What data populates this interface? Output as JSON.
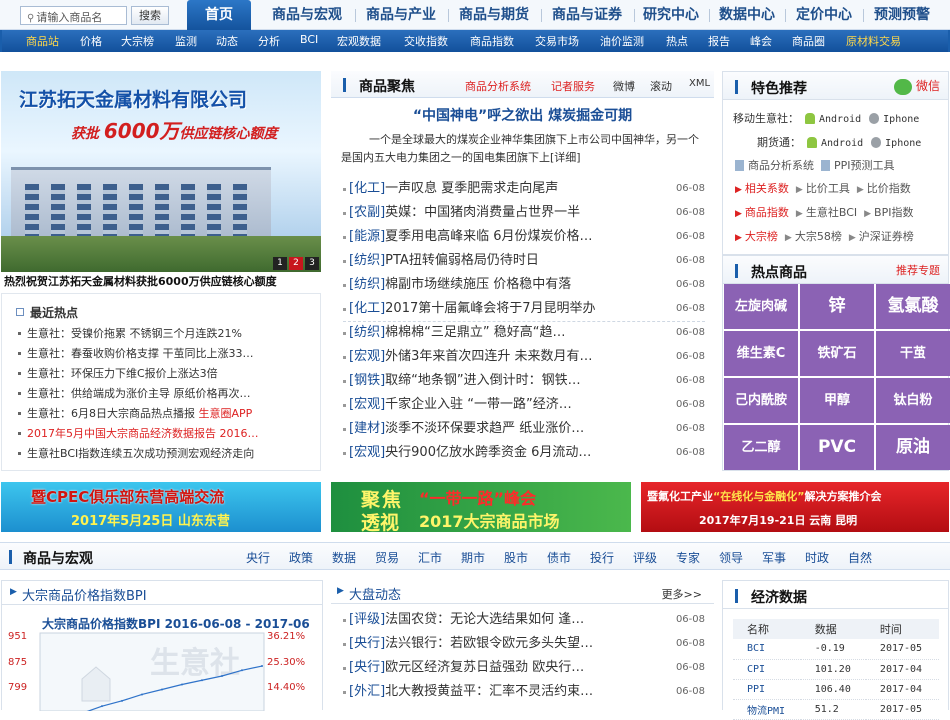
{
  "search": {
    "placeholder": "请输入商品名",
    "button": "搜索"
  },
  "main_nav": [
    "首页",
    "商品与宏观",
    "商品与产业",
    "商品与期货",
    "商品与证券",
    "研究中心",
    "数据中心",
    "定价中心",
    "预测预警"
  ],
  "sub_nav": [
    "商品站",
    "价格",
    "大宗榜",
    "监测",
    "动态",
    "分析",
    "BCI",
    "宏观数据",
    "交收指数",
    "商品指数",
    "交易市场",
    "油价监测",
    "热点",
    "报告",
    "峰会",
    "商品圈",
    "原材料交易"
  ],
  "hero": {
    "company": "江苏拓天金属材料有限公司",
    "line_pre": "获批",
    "line_amount": "6000万",
    "line_post": "供应链核心额度",
    "pages": [
      "1",
      "2",
      "3"
    ],
    "caption": "热烈祝贺江苏拓天金属材料获批6000万供应链核心额度"
  },
  "recent_hot": {
    "title": "最近热点",
    "items": [
      "生意社：受镍价拖累 不锈钢三个月连跌21%",
      "生意社：春蚕收购价格支撑 干茧同比上涨33…",
      "生意社：环保压力下维C报价上涨达3倍",
      "生意社：供给端成为涨价主导 原纸价格再次…",
      "生意社：6月8日大宗商品热点播报",
      "2017年5月中国大宗商品经济数据报告 2016…",
      "生意社BCI指数连续五次成功预测宏观经济走向"
    ],
    "app_link": "生意圈APP"
  },
  "focus": {
    "title": "商品聚焦",
    "links": [
      "商品分析系统",
      "记者服务",
      "微博",
      "滚动",
      "XML"
    ],
    "headline": "“中国神电”呼之欲出 煤炭掘金可期",
    "summary": "一个是全球最大的煤炭企业神华集团旗下上市公司中国神华，另一个是国内五大电力集团之一的国电集团旗下上[详细]",
    "news": [
      {
        "tag": "[化工]",
        "title": "一声叹息 夏季肥需求走向尾声",
        "date": "06-08"
      },
      {
        "tag": "[农副]",
        "title": "英媒：中国猪肉消费量占世界一半",
        "date": "06-08"
      },
      {
        "tag": "[能源]",
        "title": "夏季用电高峰来临 6月份煤炭价格…",
        "date": "06-08"
      },
      {
        "tag": "[纺织]",
        "title": "PTA扭转偏弱格局仍待时日",
        "date": "06-08"
      },
      {
        "tag": "[纺织]",
        "title": "棉副市场继续施压 价格稳中有落",
        "date": "06-08"
      },
      {
        "tag": "[化工]",
        "title": "2017第十届氟峰会将于7月昆明举办",
        "date": "06-08"
      },
      {
        "tag": "[纺织]",
        "title": "棉棉棉“三足鼎立” 稳好高“趋…",
        "date": "06-08"
      },
      {
        "tag": "[宏观]",
        "title": "外储3年来首次四连升 未来数月有…",
        "date": "06-08"
      },
      {
        "tag": "[钢铁]",
        "title": "取缔“地条钢”进入倒计时：钢铁…",
        "date": "06-08"
      },
      {
        "tag": "[宏观]",
        "title": "千家企业入驻 “一带一路”经济…",
        "date": "06-08"
      },
      {
        "tag": "[建材]",
        "title": "淡季不淡环保要求趋严 纸业涨价…",
        "date": "06-08"
      },
      {
        "tag": "[宏观]",
        "title": "央行900亿放水跨季资金 6月流动…",
        "date": "06-08"
      }
    ]
  },
  "recommend": {
    "title": "特色推荐",
    "weixin": "微信",
    "mobile_label": "移动生意社：",
    "futures_label": "期货通：",
    "android": "Android",
    "iphone": "Iphone",
    "tools": [
      "商品分析系统",
      "PPI预测工具"
    ],
    "rows": [
      [
        "相关系数",
        "比价工具",
        "比价指数"
      ],
      [
        "商品指数",
        "生意社BCI",
        "BPI指数"
      ],
      [
        "大宗榜",
        "大宗58榜",
        "沪深证券榜"
      ]
    ]
  },
  "hot_products": {
    "title": "热点商品",
    "topic": "推荐专题",
    "items": [
      "左旋肉碱",
      "锌",
      "氢氯酸",
      "维生素C",
      "铁矿石",
      "干茧",
      "己内酰胺",
      "甲醇",
      "钛白粉",
      "乙二醇",
      "PVC",
      "原油"
    ]
  },
  "ads": {
    "a1_line1": "暨CPEC俱乐部东营高端交流",
    "a1_line2": "2017年5月25日 山东东营",
    "a2_w1": "聚焦",
    "a2_w2": "透视",
    "a2_line1": "“一带一路”峰会",
    "a2_line2": "2017大宗商品市场",
    "a3_pre": "暨氟化工产业",
    "a3_hl": "“在线化与金融化”",
    "a3_post": "解决方案推介会",
    "a3_line2": "2017年7月19-21日  云南 昆明"
  },
  "macro": {
    "title": "商品与宏观",
    "links": [
      "央行",
      "政策",
      "数据",
      "贸易",
      "汇市",
      "期市",
      "股市",
      "债市",
      "投行",
      "评级",
      "专家",
      "领导",
      "军事",
      "时政",
      "自然"
    ]
  },
  "bpi": {
    "title": "大宗商品价格指数BPI",
    "chart_title": "大宗商品价格指数BPI 2016-06-08 - 2017-06",
    "left_ticks": [
      "951",
      "875",
      "799"
    ],
    "right_ticks": [
      "36.21%",
      "25.30%",
      "14.40%"
    ],
    "watermark": "生意社",
    "chart_data": {
      "type": "line",
      "title": "大宗商品价格指数BPI 2016-06-08 - 2017-06",
      "ylim": [
        799,
        951
      ],
      "left_ticks": [
        951,
        875,
        799
      ],
      "right_ticks": [
        "36.21%",
        "25.30%",
        "14.40%"
      ],
      "series": [
        {
          "values": [
            700,
            712,
            725,
            745,
            760,
            778,
            792,
            806,
            818,
            830,
            846,
            858
          ]
        }
      ]
    }
  },
  "dapan": {
    "title": "大盘动态",
    "more": "更多>>",
    "news": [
      {
        "tag": "[评级]",
        "title": "法国农贷：无论大选结果如何 逢…",
        "date": "06-08"
      },
      {
        "tag": "[央行]",
        "title": "法兴银行：若欧银令欧元多头失望…",
        "date": "06-08"
      },
      {
        "tag": "[央行]",
        "title": "欧元区经济复苏日益强劲 欧央行…",
        "date": "06-08"
      },
      {
        "tag": "[外汇]",
        "title": "北大教授黄益平：汇率不灵活约束…",
        "date": "06-08"
      }
    ]
  },
  "econ": {
    "title": "经济数据",
    "headers": [
      "名称",
      "数据",
      "时间"
    ],
    "rows": [
      [
        "BCI",
        "-0.19",
        "2017-05"
      ],
      [
        "CPI",
        "101.20",
        "2017-04"
      ],
      [
        "PPI",
        "106.40",
        "2017-04"
      ],
      [
        "物流PMI",
        "51.2",
        "2017-05"
      ]
    ]
  }
}
